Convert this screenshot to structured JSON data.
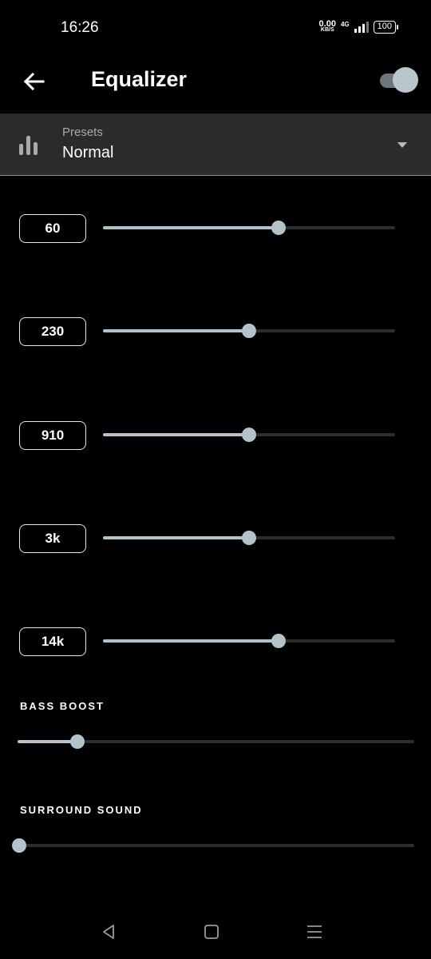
{
  "status": {
    "time": "16:26",
    "speed_value": "0.00",
    "speed_unit": "KB/S",
    "network": "4G",
    "battery": "100"
  },
  "header": {
    "title": "Equalizer",
    "enabled": true
  },
  "presets": {
    "label": "Presets",
    "value": "Normal"
  },
  "bands": [
    {
      "label": "60",
      "level": 0.6
    },
    {
      "label": "230",
      "level": 0.5
    },
    {
      "label": "910",
      "level": 0.5
    },
    {
      "label": "3k",
      "level": 0.5
    },
    {
      "label": "14k",
      "level": 0.6
    }
  ],
  "bass_boost": {
    "label": "BASS BOOST",
    "level": 0.15
  },
  "surround_sound": {
    "label": "SURROUND SOUND",
    "level": 0.0
  },
  "colors": {
    "background": "#000000",
    "accent": "#b4c2c9",
    "panel": "#2a2b2d"
  }
}
